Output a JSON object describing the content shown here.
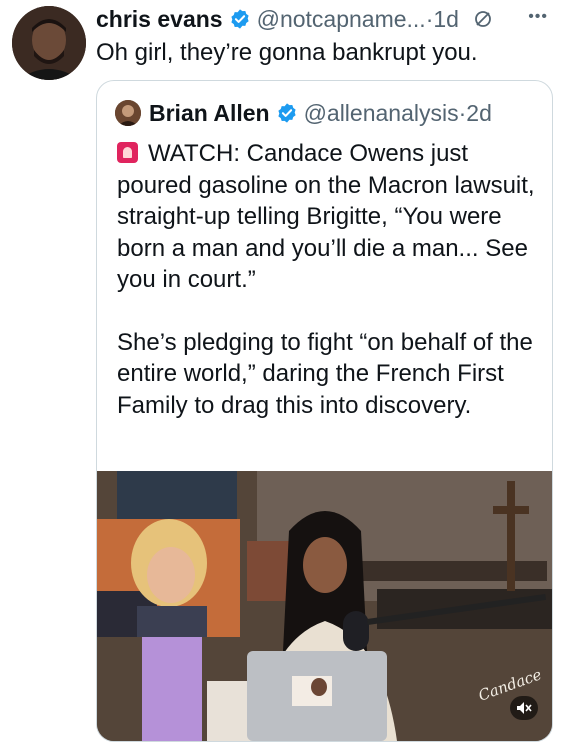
{
  "tweet": {
    "author_name": "chris evans",
    "author_handle": "@notcapname...",
    "separator": "·",
    "time": "1d",
    "text": "Oh girl, they’re gonna bankrupt you."
  },
  "quote": {
    "author_name": "Brian Allen",
    "author_handle": "@allenanalysis",
    "separator": "·",
    "time": "2d",
    "paragraph1": "WATCH: Candace Owens just poured gasoline on the Macron lawsuit, straight-up telling Brigitte, “You were born a man and you’ll die a man... See you in court.”",
    "paragraph2": "She’s pledging to fight “on behalf of the entire world,” daring the French First Family to drag this into discovery."
  },
  "media": {
    "watermark": "Candace"
  },
  "icons": {
    "verified": "verified-badge-icon",
    "mute": "mute-icon",
    "more": "more-icon",
    "siren": "siren-icon",
    "volume_muted": "volume-muted-icon"
  },
  "colors": {
    "verified_blue": "#1d9bf0",
    "secondary_text": "#536471",
    "border": "#cfd9de"
  }
}
